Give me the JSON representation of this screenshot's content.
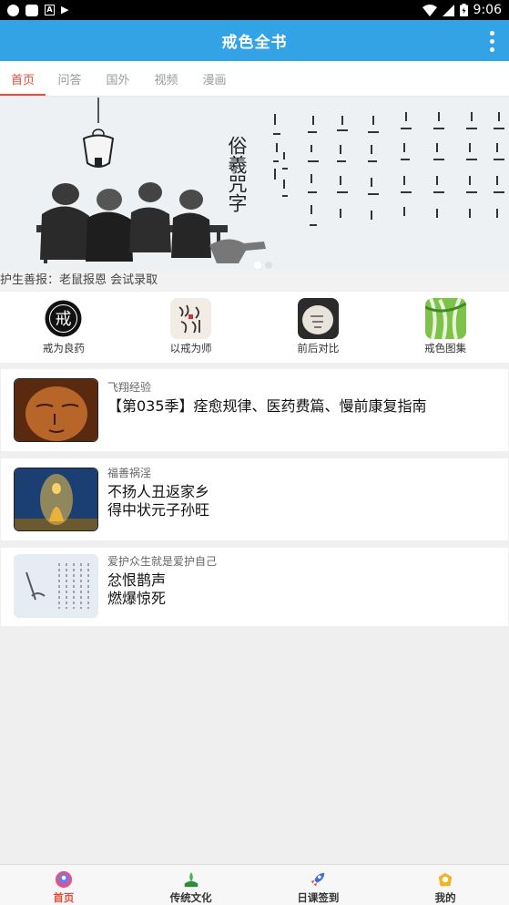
{
  "status_bar": {
    "time": "9:06"
  },
  "app_bar": {
    "title": "戒色全书"
  },
  "tabs": [
    {
      "label": "首页",
      "active": true
    },
    {
      "label": "问答",
      "active": false
    },
    {
      "label": "国外",
      "active": false
    },
    {
      "label": "视频",
      "active": false
    },
    {
      "label": "漫画",
      "active": false
    }
  ],
  "banner": {
    "calligraphy_title": "俗羲咒字"
  },
  "notice": {
    "text": "护生善报：老鼠报恩 会试录取"
  },
  "shortcuts": [
    {
      "label": "戒为良药",
      "icon": "jie-seal-icon"
    },
    {
      "label": "以戒为师",
      "icon": "calligraphy-icon"
    },
    {
      "label": "前后对比",
      "icon": "compare-icon"
    },
    {
      "label": "戒色图集",
      "icon": "bamboo-icon"
    }
  ],
  "articles": [
    {
      "source": "飞翔经验",
      "title": "【第035季】痊愈规律、医药费篇、慢前康复指南",
      "thumb": "buddha-face-thumb"
    },
    {
      "source": "福善祸淫",
      "title": "不扬人丑返家乡\n得中状元子孙旺",
      "thumb": "golden-buddha-thumb"
    },
    {
      "source": "爱护众生就是爱护自己",
      "title": "忿恨鹊声\n燃爆惊死",
      "thumb": "ink-painting-thumb"
    }
  ],
  "bottom_nav": [
    {
      "label": "首页",
      "active": true,
      "icon": "home-icon"
    },
    {
      "label": "传统文化",
      "active": false,
      "icon": "culture-icon"
    },
    {
      "label": "日课签到",
      "active": false,
      "icon": "rocket-icon"
    },
    {
      "label": "我的",
      "active": false,
      "icon": "profile-icon"
    }
  ]
}
